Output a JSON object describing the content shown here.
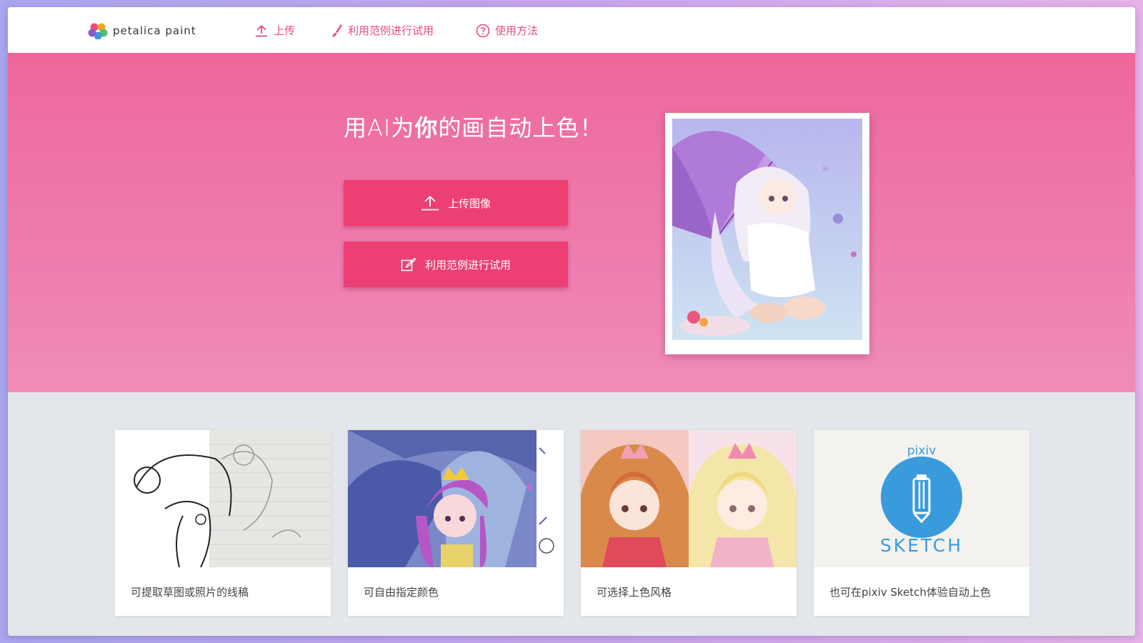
{
  "header": {
    "logo_text": "petalica paint",
    "nav": [
      {
        "label": "上传",
        "icon": "upload-icon"
      },
      {
        "label": "利用范例进行试用",
        "icon": "brush-icon"
      },
      {
        "label": "使用方法",
        "icon": "help-circle-icon"
      }
    ]
  },
  "hero": {
    "title_prefix": "用AI为",
    "title_emphasis": "你",
    "title_suffix": "的画自动上色！",
    "upload_button": "上传图像",
    "sample_button": "利用范例进行试用",
    "illustration_icon": "anime-girl-umbrella-illustration"
  },
  "features": [
    {
      "label": "可提取草图或照片的线稿",
      "image": "sketch-lineart-image"
    },
    {
      "label": "可自由指定颜色",
      "image": "colored-girl-umbrella-image"
    },
    {
      "label": "可选择上色风格",
      "image": "style-comparison-image"
    },
    {
      "label": "也可在pixiv Sketch体验自动上色",
      "image": "pixiv-sketch-logo",
      "brand_top": "pixiv",
      "brand_bottom": "SKETCH"
    }
  ],
  "colors": {
    "accent": "#e84a80",
    "hero_pink": "#ee679b",
    "button": "#ec3f73",
    "pixiv_blue": "#3a9bdc"
  }
}
